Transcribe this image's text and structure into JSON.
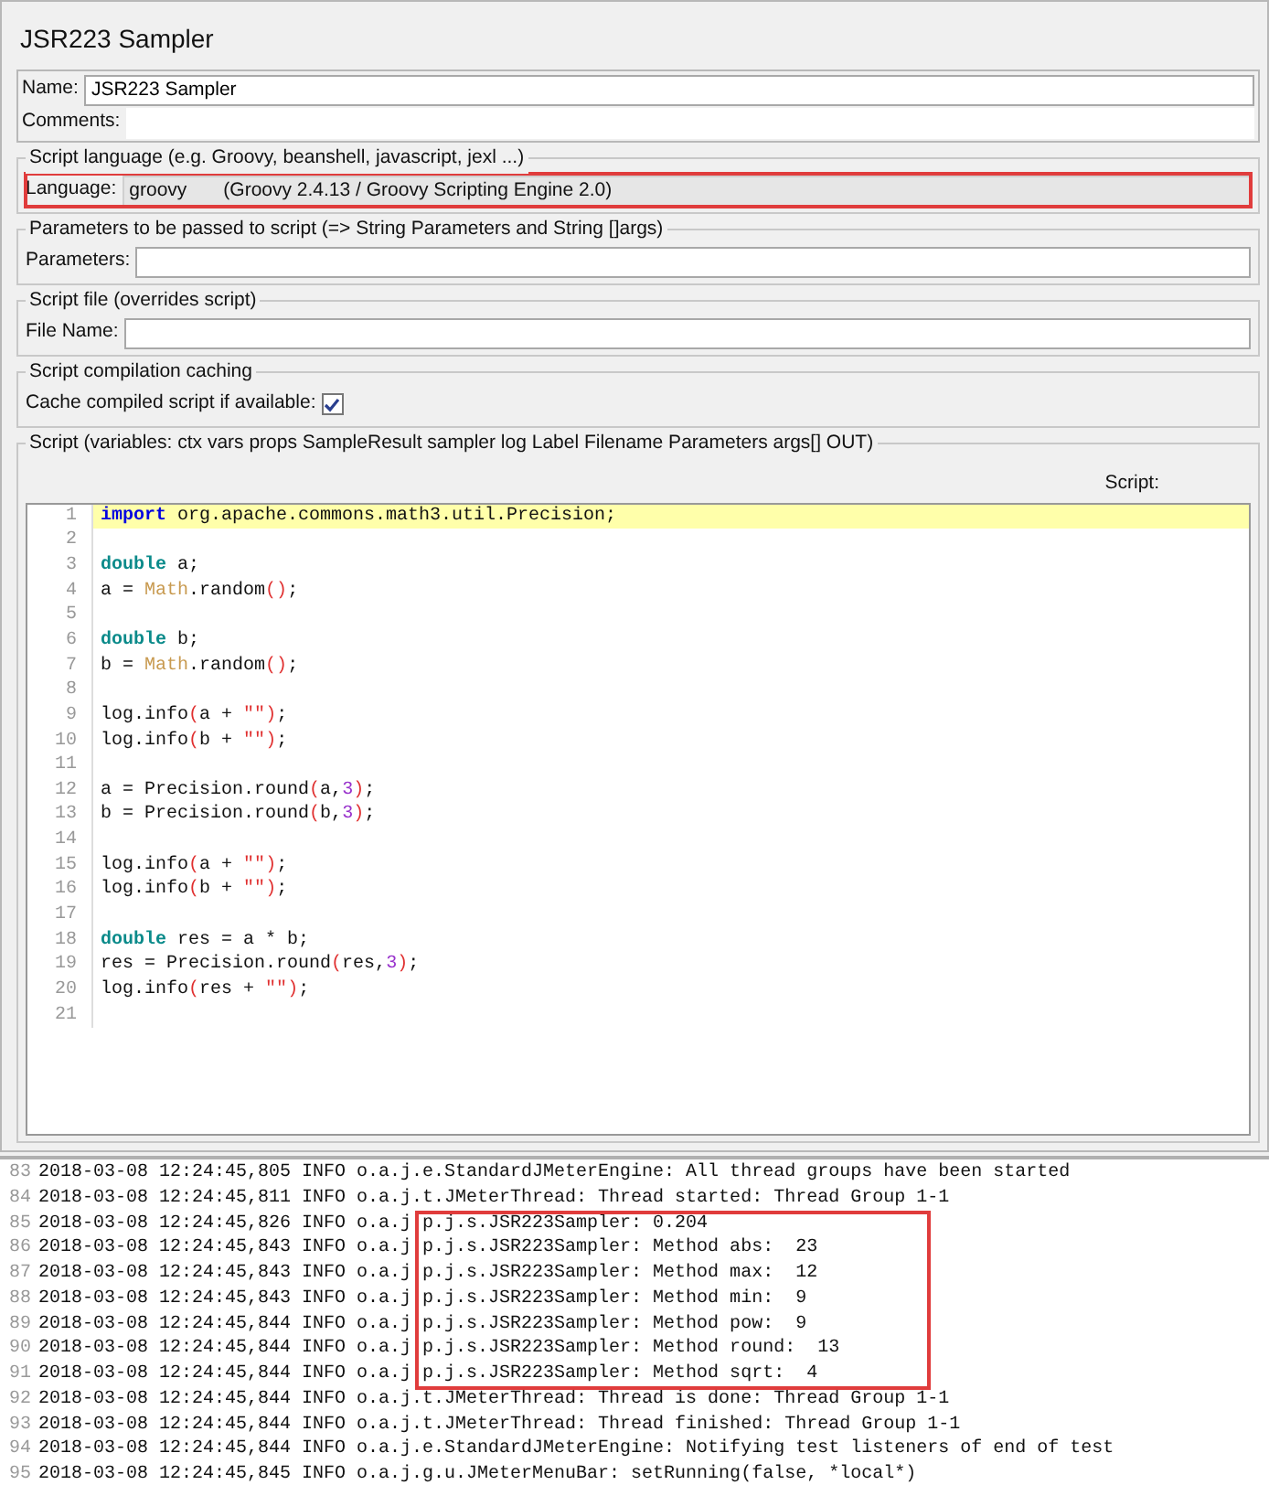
{
  "title": "JSR223 Sampler",
  "name_field": {
    "label": "Name:",
    "value": "JSR223 Sampler"
  },
  "comments_field": {
    "label": "Comments:"
  },
  "language_group": {
    "legend": "Script language (e.g. Groovy, beanshell, javascript, jexl ...)",
    "label": "Language:",
    "value": "groovy",
    "engine": "(Groovy 2.4.13 / Groovy Scripting Engine 2.0)",
    "highlighted": true
  },
  "parameters_group": {
    "legend": "Parameters to be passed to script (=> String Parameters and String []args)",
    "label": "Parameters:"
  },
  "file_group": {
    "legend": "Script file (overrides script)",
    "label": "File Name:"
  },
  "caching_group": {
    "legend": "Script compilation caching",
    "label": "Cache compiled script if available:",
    "checked": true
  },
  "script_group": {
    "legend": "Script (variables: ctx vars props SampleResult sampler log Label Filename Parameters args[] OUT)",
    "label": "Script:",
    "lines": [
      {
        "number": "1",
        "current": true,
        "tokens": [
          {
            "kind": "import",
            "text": "import"
          },
          {
            "kind": "text",
            "text": " org.apache.commons.math3.util.Precision;"
          }
        ]
      },
      {
        "number": "2",
        "current": false
      },
      {
        "number": "3",
        "current": false,
        "tokens": [
          {
            "kind": "type",
            "text": "double"
          },
          {
            "kind": "text",
            "text": " a;"
          }
        ]
      },
      {
        "number": "4",
        "current": false,
        "tokens": [
          {
            "kind": "text",
            "text": "a = "
          },
          {
            "kind": "class",
            "text": "Math"
          },
          {
            "kind": "text",
            "text": ".random"
          },
          {
            "kind": "paren",
            "text": "()"
          },
          {
            "kind": "text",
            "text": ";"
          }
        ]
      },
      {
        "number": "5",
        "current": false
      },
      {
        "number": "6",
        "current": false,
        "tokens": [
          {
            "kind": "type",
            "text": "double"
          },
          {
            "kind": "text",
            "text": " b;"
          }
        ]
      },
      {
        "number": "7",
        "current": false,
        "tokens": [
          {
            "kind": "text",
            "text": "b = "
          },
          {
            "kind": "class",
            "text": "Math"
          },
          {
            "kind": "text",
            "text": ".random"
          },
          {
            "kind": "paren",
            "text": "()"
          },
          {
            "kind": "text",
            "text": ";"
          }
        ]
      },
      {
        "number": "8",
        "current": false
      },
      {
        "number": "9",
        "current": false,
        "tokens": [
          {
            "kind": "text",
            "text": "log.info"
          },
          {
            "kind": "paren",
            "text": "("
          },
          {
            "kind": "text",
            "text": "a + "
          },
          {
            "kind": "string",
            "text": "\"\""
          },
          {
            "kind": "paren",
            "text": ")"
          },
          {
            "kind": "text",
            "text": ";"
          }
        ]
      },
      {
        "number": "10",
        "current": false,
        "tokens": [
          {
            "kind": "text",
            "text": "log.info"
          },
          {
            "kind": "paren",
            "text": "("
          },
          {
            "kind": "text",
            "text": "b + "
          },
          {
            "kind": "string",
            "text": "\"\""
          },
          {
            "kind": "paren",
            "text": ")"
          },
          {
            "kind": "text",
            "text": ";"
          }
        ]
      },
      {
        "number": "11",
        "current": false
      },
      {
        "number": "12",
        "current": false,
        "tokens": [
          {
            "kind": "text",
            "text": "a = Precision.round"
          },
          {
            "kind": "paren",
            "text": "("
          },
          {
            "kind": "text",
            "text": "a,"
          },
          {
            "kind": "number",
            "text": "3"
          },
          {
            "kind": "paren",
            "text": ")"
          },
          {
            "kind": "text",
            "text": ";"
          }
        ]
      },
      {
        "number": "13",
        "current": false,
        "tokens": [
          {
            "kind": "text",
            "text": "b = Precision.round"
          },
          {
            "kind": "paren",
            "text": "("
          },
          {
            "kind": "text",
            "text": "b,"
          },
          {
            "kind": "number",
            "text": "3"
          },
          {
            "kind": "paren",
            "text": ")"
          },
          {
            "kind": "text",
            "text": ";"
          }
        ]
      },
      {
        "number": "14",
        "current": false
      },
      {
        "number": "15",
        "current": false,
        "tokens": [
          {
            "kind": "text",
            "text": "log.info"
          },
          {
            "kind": "paren",
            "text": "("
          },
          {
            "kind": "text",
            "text": "a + "
          },
          {
            "kind": "string",
            "text": "\"\""
          },
          {
            "kind": "paren",
            "text": ")"
          },
          {
            "kind": "text",
            "text": ";"
          }
        ]
      },
      {
        "number": "16",
        "current": false,
        "tokens": [
          {
            "kind": "text",
            "text": "log.info"
          },
          {
            "kind": "paren",
            "text": "("
          },
          {
            "kind": "text",
            "text": "b + "
          },
          {
            "kind": "string",
            "text": "\"\""
          },
          {
            "kind": "paren",
            "text": ")"
          },
          {
            "kind": "text",
            "text": ";"
          }
        ]
      },
      {
        "number": "17",
        "current": false
      },
      {
        "number": "18",
        "current": false,
        "tokens": [
          {
            "kind": "type",
            "text": "double"
          },
          {
            "kind": "text",
            "text": " res = a * b;"
          }
        ]
      },
      {
        "number": "19",
        "current": false,
        "tokens": [
          {
            "kind": "text",
            "text": "res = Precision.round"
          },
          {
            "kind": "paren",
            "text": "("
          },
          {
            "kind": "text",
            "text": "res,"
          },
          {
            "kind": "number",
            "text": "3"
          },
          {
            "kind": "paren",
            "text": ")"
          },
          {
            "kind": "text",
            "text": ";"
          }
        ]
      },
      {
        "number": "20",
        "current": false,
        "tokens": [
          {
            "kind": "text",
            "text": "log.info"
          },
          {
            "kind": "paren",
            "text": "("
          },
          {
            "kind": "text",
            "text": "res + "
          },
          {
            "kind": "string",
            "text": "\"\""
          },
          {
            "kind": "paren",
            "text": ")"
          },
          {
            "kind": "text",
            "text": ";"
          }
        ]
      },
      {
        "number": "21",
        "current": false
      }
    ]
  },
  "log": [
    {
      "number": "83",
      "text": "2018-03-08 12:24:45,805 INFO o.a.j.e.StandardJMeterEngine: All thread groups have been started",
      "highlighted": false
    },
    {
      "number": "84",
      "text": "2018-03-08 12:24:45,811 INFO o.a.j.t.JMeterThread: Thread started: Thread Group 1-1",
      "highlighted": false
    },
    {
      "number": "85",
      "text": "2018-03-08 12:24:45,826 INFO o.a.j.p.j.s.JSR223Sampler: 0.204",
      "highlighted": true
    },
    {
      "number": "86",
      "text": "2018-03-08 12:24:45,843 INFO o.a.j.p.j.s.JSR223Sampler: Method abs:  23",
      "highlighted": true
    },
    {
      "number": "87",
      "text": "2018-03-08 12:24:45,843 INFO o.a.j.p.j.s.JSR223Sampler: Method max:  12",
      "highlighted": true
    },
    {
      "number": "88",
      "text": "2018-03-08 12:24:45,843 INFO o.a.j.p.j.s.JSR223Sampler: Method min:  9",
      "highlighted": true
    },
    {
      "number": "89",
      "text": "2018-03-08 12:24:45,844 INFO o.a.j.p.j.s.JSR223Sampler: Method pow:  9",
      "highlighted": true
    },
    {
      "number": "90",
      "text": "2018-03-08 12:24:45,844 INFO o.a.j.p.j.s.JSR223Sampler: Method round:  13",
      "highlighted": true
    },
    {
      "number": "91",
      "text": "2018-03-08 12:24:45,844 INFO o.a.j.p.j.s.JSR223Sampler: Method sqrt:  4",
      "highlighted": true
    },
    {
      "number": "92",
      "text": "2018-03-08 12:24:45,844 INFO o.a.j.t.JMeterThread: Thread is done: Thread Group 1-1",
      "highlighted": false
    },
    {
      "number": "93",
      "text": "2018-03-08 12:24:45,844 INFO o.a.j.t.JMeterThread: Thread finished: Thread Group 1-1",
      "highlighted": false
    },
    {
      "number": "94",
      "text": "2018-03-08 12:24:45,844 INFO o.a.j.e.StandardJMeterEngine: Notifying test listeners of end of test",
      "highlighted": false
    },
    {
      "number": "95",
      "text": "2018-03-08 12:24:45,845 INFO o.a.j.g.u.JMeterMenuBar: setRunning(false, *local*)",
      "highlighted": false
    }
  ]
}
